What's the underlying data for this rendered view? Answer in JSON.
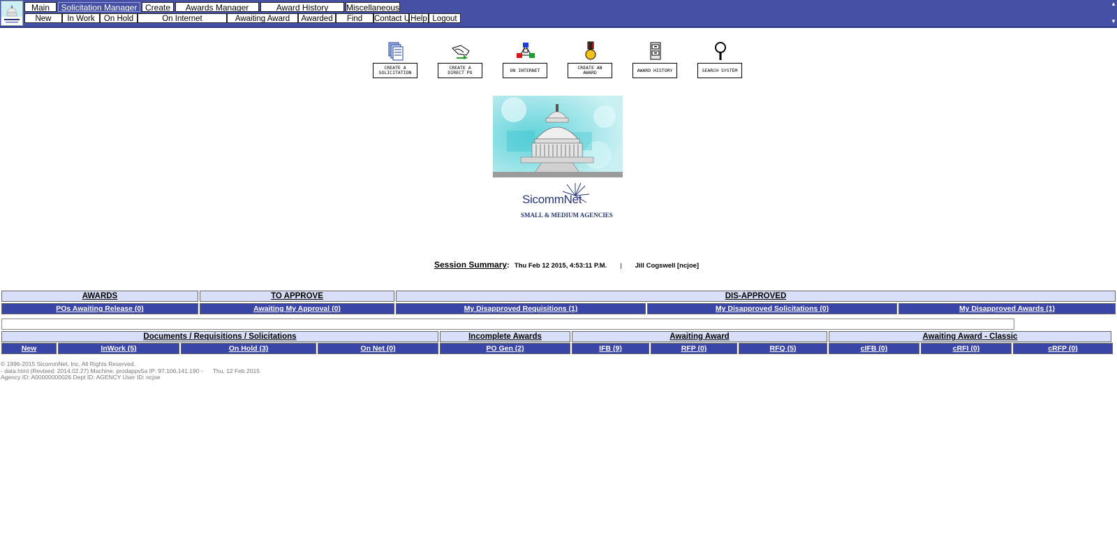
{
  "nav": {
    "tabs_row1": [
      "Main",
      "Solicitation Manager",
      "Create",
      "Awards Manager",
      "Award History",
      "Miscellaneous"
    ],
    "tabs_row2": [
      "New",
      "In Work",
      "On Hold",
      "On Internet",
      "Awaiting Award",
      "Awarded",
      "Find",
      "Contact Us",
      "Help",
      "Logout"
    ],
    "active_tab": "Solicitation Manager"
  },
  "quick_actions": [
    {
      "label": "CREATE A SOLICITATION",
      "icon": "document-stack-icon"
    },
    {
      "label": "CREATE A DIRECT PO",
      "icon": "signing-hand-icon"
    },
    {
      "label": "ON INTERNET",
      "icon": "network-icon"
    },
    {
      "label": "CREATE AN AWARD",
      "icon": "medal-icon"
    },
    {
      "label": "AWARD HISTORY",
      "icon": "file-cabinet-icon"
    },
    {
      "label": "SEARCH SYSTEM",
      "icon": "magnifier-icon"
    }
  ],
  "brand": {
    "name": "SicommNet",
    "tag": "SMALL &  MEDIUM AGENCIES"
  },
  "session": {
    "label": "Session Summary",
    "datetime": "Thu Feb 12 2015, 4:53:11 P.M.",
    "separator": "|",
    "user": "Jill Cogswell [ncjoe]"
  },
  "table1": {
    "headers": [
      "AWARDS",
      "TO APPROVE",
      "DIS-APPROVED"
    ],
    "links": [
      "POs Awaiting Release (0)",
      "Awaiting My Approval (0)",
      "My Disapproved Requisitions (1)",
      "My Disapproved Solicitations (0)",
      "My Disapproved Awards (1)"
    ]
  },
  "table2": {
    "headers": [
      "Documents / Requisitions / Solicitations",
      "Incomplete Awards",
      "Awaiting Award",
      "Awaiting Award - Classic"
    ],
    "links": [
      "New",
      "InWork (5)",
      "On Hold (3)",
      "On Net (0)",
      "PO Gen (2)",
      "IFB (9)",
      "RFP (0)",
      "RFQ (5)",
      "cIFB (0)",
      "cRFI (0)",
      "cRFP (0)"
    ]
  },
  "footer": {
    "copyright": "© 1996-2015 SicommNet, Inc. All Rights Reserved.",
    "machine": "- data.html (Revised: 2014.02.27) Machine: prodappv5a IP: 97.106.141.190 -",
    "date": "Thu, 12 Feb 2015",
    "ids": "Agency ID: A00000000026 Dept ID: AGENCY User ID: ncjoe"
  },
  "colors": {
    "nav_bg": "#4650a4",
    "header_cell": "#d9def9",
    "link_cell": "#3a45a8"
  }
}
